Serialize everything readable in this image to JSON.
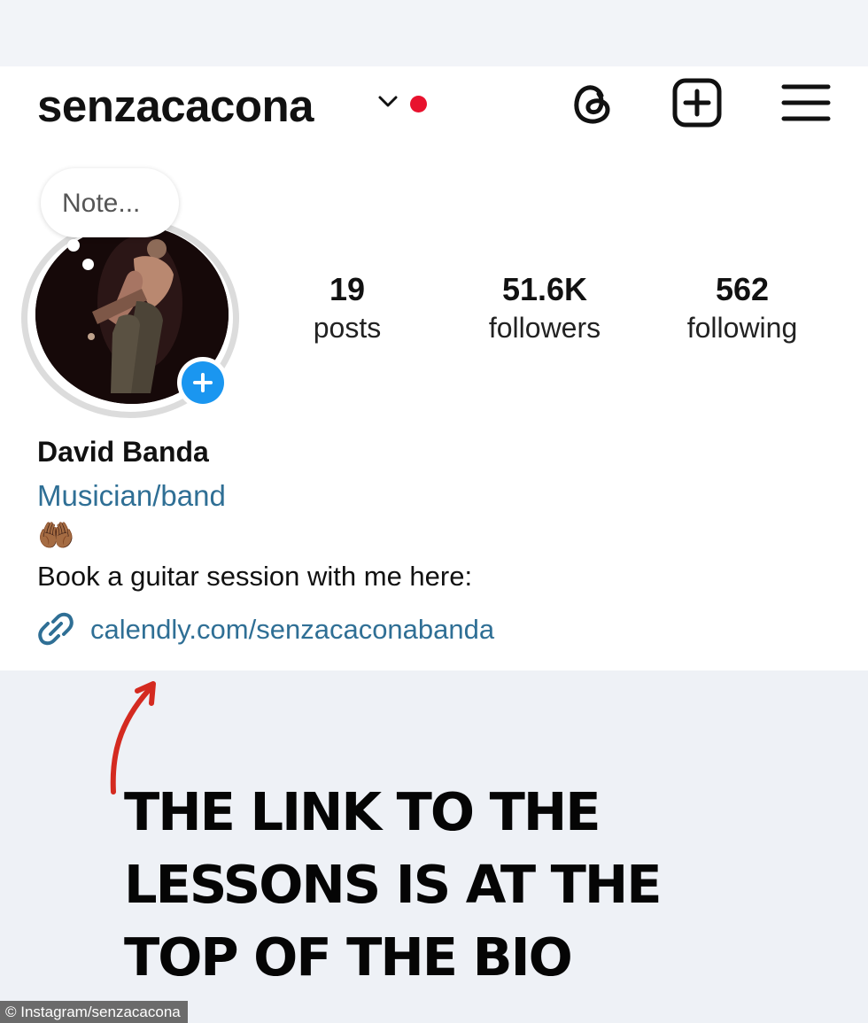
{
  "header": {
    "username": "senzacacona"
  },
  "profile": {
    "note_placeholder": "Note...",
    "stats": [
      {
        "value": "19",
        "label": "posts"
      },
      {
        "value": "51.6K",
        "label": "followers"
      },
      {
        "value": "562",
        "label": "following"
      }
    ],
    "display_name": "David Banda",
    "category": "Musician/band",
    "bio_emoji": "🤲🏾",
    "bio_text": "Book a guitar session with me here:",
    "link_text": "calendly.com/senzacaconabanda"
  },
  "overlay": {
    "caption_lines": [
      "THE LINK TO THE",
      "LESSONS IS AT THE",
      "TOP OF THE BIO"
    ],
    "credit": "© Instagram/senzacacona"
  },
  "colors": {
    "link_blue": "#2f6f95",
    "notification_red": "#e8122e",
    "add_story_blue": "#1a96f0",
    "arrow_red": "#d42a20"
  },
  "icons": [
    "chevron-down-icon",
    "threads-icon",
    "create-icon",
    "menu-icon",
    "plus-icon",
    "link-icon",
    "arrow-icon"
  ]
}
